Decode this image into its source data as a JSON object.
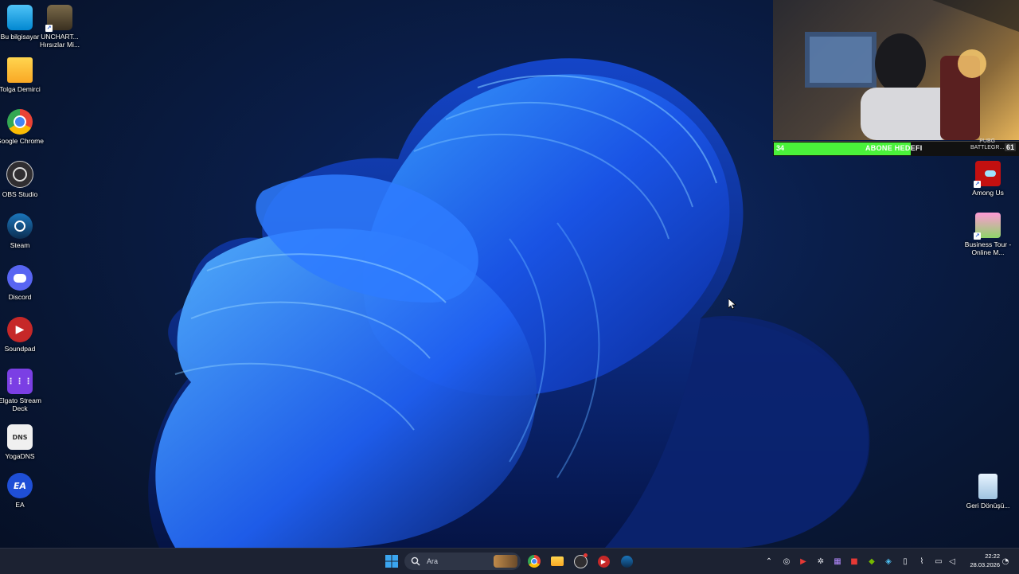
{
  "desktop_left": [
    {
      "label": "Bu bilgisayar"
    },
    {
      "label": "UNCHART... Hırsızlar Mi..."
    },
    {
      "label": "Tolga Demirci"
    },
    {
      "label": "Google Chrome"
    },
    {
      "label": "OBS Studio"
    },
    {
      "label": "Steam"
    },
    {
      "label": "Discord"
    },
    {
      "label": "Soundpad"
    },
    {
      "label": "Elgato Stream Deck"
    },
    {
      "label": "YogaDNS"
    },
    {
      "label": "EA"
    }
  ],
  "desktop_right": [
    {
      "label": "Among Us"
    },
    {
      "label": "Business Tour - Online M..."
    },
    {
      "label": "Geri Dönüşü..."
    }
  ],
  "overlay": {
    "goal_current": "34",
    "goal_title": "ABONE HEDEFI",
    "goal_target": "61",
    "goal_fraction": 0.56,
    "game_label_1": "PUBG",
    "game_label_2": "BATTLEGR..."
  },
  "taskbar": {
    "search_placeholder": "Ara",
    "time": "22:22",
    "date": "28.03.2026"
  },
  "colors": {
    "taskbar_bg": "#1c2232",
    "goal_fill": "#4af23a",
    "wallpaper_accent": "#1e6bff"
  }
}
